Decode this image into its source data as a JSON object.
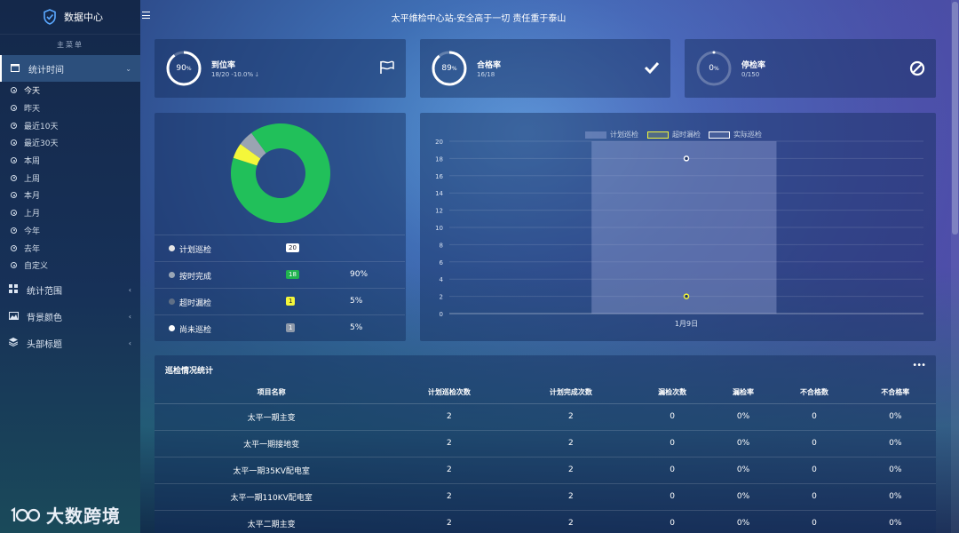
{
  "sidebar": {
    "brand": "数据中心",
    "menu_header": "主菜单",
    "items": [
      {
        "label": "统计时间",
        "icon": "calendar-icon"
      },
      {
        "label": "统计范围",
        "icon": "grid-icon"
      },
      {
        "label": "背景颜色",
        "icon": "image-icon"
      },
      {
        "label": "头部标题",
        "icon": "layers-icon"
      }
    ],
    "time_options": [
      "今天",
      "昨天",
      "最近10天",
      "最近30天",
      "本周",
      "上周",
      "本月",
      "上月",
      "今年",
      "去年",
      "自定义"
    ],
    "selected_time": "今天"
  },
  "header": {
    "title": "太平维检中心站-安全高于一切 责任重于泰山"
  },
  "kpis": [
    {
      "title": "到位率",
      "value": "90",
      "unit": "%",
      "detail": "18/20 -10.0%",
      "fraction": 0.9,
      "icon": "flag-icon"
    },
    {
      "title": "合格率",
      "value": "89",
      "unit": "%",
      "detail": "16/18",
      "fraction": 0.89,
      "icon": "check-icon"
    },
    {
      "title": "停检率",
      "value": "0",
      "unit": "%",
      "detail": "0/150",
      "fraction": 0.0,
      "icon": "ban-icon"
    }
  ],
  "summary": {
    "rows": [
      {
        "label": "计划巡检",
        "badge": "20",
        "percent": "",
        "dot": "#e6e6e6",
        "badge_bg": "#ffffff",
        "badge_fg": "#223"
      },
      {
        "label": "按时完成",
        "badge": "18",
        "percent": "90%",
        "dot": "#9aa6b6",
        "badge_bg": "#21b34f",
        "badge_fg": "#fff"
      },
      {
        "label": "超时漏检",
        "badge": "1",
        "percent": "5%",
        "dot": "#5f6f86",
        "badge_bg": "#f4f73a",
        "badge_fg": "#223"
      },
      {
        "label": "尚未巡检",
        "badge": "1",
        "percent": "5%",
        "dot": "#ffffff",
        "badge_bg": "#8f9aaa",
        "badge_fg": "#fff"
      }
    ],
    "donut": [
      {
        "name": "按时完成",
        "value": 18,
        "color": "#21c05a"
      },
      {
        "name": "超时漏检",
        "value": 1,
        "color": "#f4f73a"
      },
      {
        "name": "尚未巡检",
        "value": 1,
        "color": "#9aa4b2"
      }
    ]
  },
  "chart_data": {
    "type": "bar",
    "categories": [
      "1月9日"
    ],
    "series": [
      {
        "name": "计划巡检",
        "values": [
          20
        ],
        "color": "#9aa6e0"
      },
      {
        "name": "超时漏检",
        "values": [
          2
        ],
        "color": "#f4f73a"
      },
      {
        "name": "实际巡检",
        "values": [
          18
        ],
        "color": "#ffffff"
      }
    ],
    "ylim": [
      0,
      20
    ],
    "yticks": [
      "0",
      "2",
      "4",
      "6",
      "8",
      "10",
      "12",
      "14",
      "16",
      "18",
      "20"
    ],
    "legend": "top"
  },
  "table": {
    "title": "巡检情况统计",
    "more": "•••",
    "columns": [
      "项目名称",
      "计划巡检次数",
      "计划完成次数",
      "漏检次数",
      "漏检率",
      "不合格数",
      "不合格率"
    ],
    "rows": [
      [
        "太平一期主变",
        "2",
        "2",
        "0",
        "0%",
        "0",
        "0%"
      ],
      [
        "太平一期接地变",
        "2",
        "2",
        "0",
        "0%",
        "0",
        "0%"
      ],
      [
        "太平一期35KV配电室",
        "2",
        "2",
        "0",
        "0%",
        "0",
        "0%"
      ],
      [
        "太平一期110KV配电室",
        "2",
        "2",
        "0",
        "0%",
        "0",
        "0%"
      ],
      [
        "太平二期主变",
        "2",
        "2",
        "0",
        "0%",
        "0",
        "0%"
      ]
    ]
  },
  "watermark": {
    "text": "大数跨境"
  }
}
